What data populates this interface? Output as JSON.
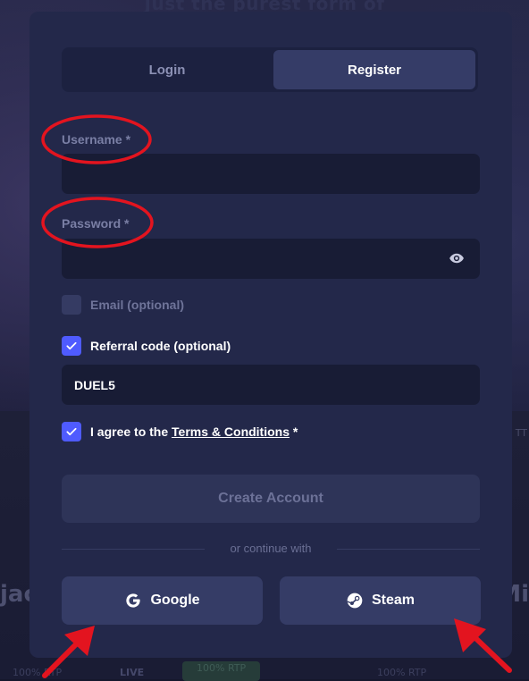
{
  "background": {
    "headline": "Just the purest form of",
    "side_left": "jac",
    "side_right": "Mi",
    "side_mid": "TT",
    "footer": {
      "item1": "100% RTP",
      "item2": "LIVE",
      "item3": "100% RTP",
      "item4": "100% RTP"
    }
  },
  "tabs": [
    {
      "label": "Login",
      "active": false
    },
    {
      "label": "Register",
      "active": true
    }
  ],
  "form": {
    "username_label": "Username *",
    "username_value": "",
    "password_label": "Password *",
    "password_value": "",
    "email_label": "Email (optional)",
    "email_checked": false,
    "referral_label": "Referral code (optional)",
    "referral_checked": true,
    "referral_value": "DUEL5",
    "terms_prefix": "I agree to the ",
    "terms_link": "Terms & Conditions",
    "terms_suffix": " *",
    "terms_checked": true,
    "create_button": "Create Account",
    "divider": "or continue with",
    "google_button": "Google",
    "steam_button": "Steam"
  },
  "colors": {
    "modal_bg": "#23284a",
    "input_bg": "#181c35",
    "accent": "#4f5bff",
    "annotation": "#e3141f"
  },
  "icons": [
    "eye-icon",
    "check-icon",
    "google-icon",
    "steam-icon"
  ]
}
